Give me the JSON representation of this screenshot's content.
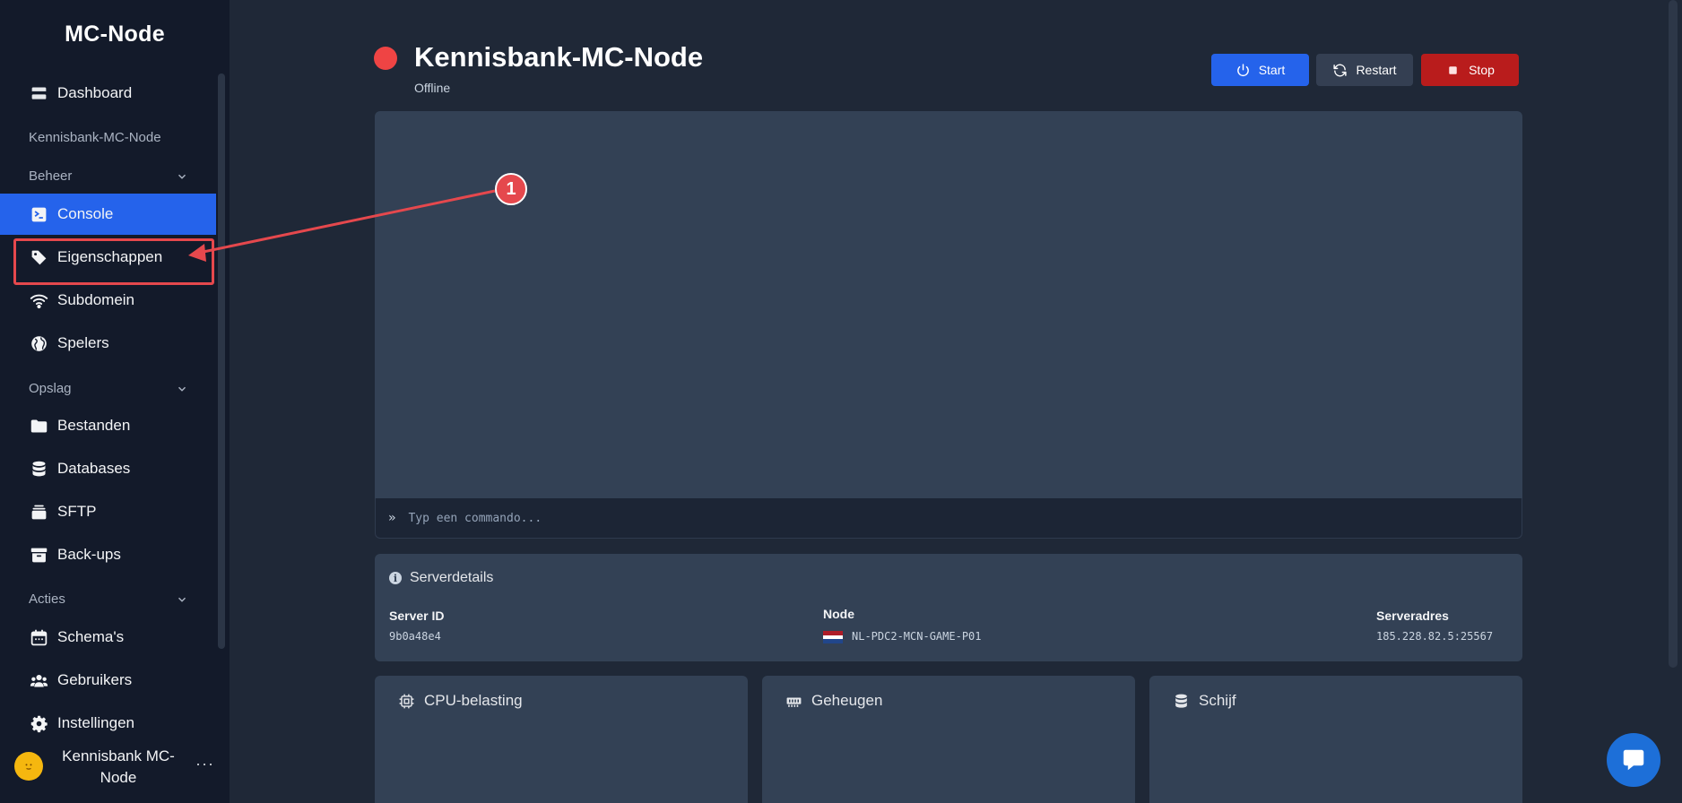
{
  "sidebar": {
    "brand": "MC-Node",
    "dashboard": "Dashboard",
    "server_heading": "Kennisbank-MC-Node",
    "sections": {
      "beheer": "Beheer",
      "opslag": "Opslag",
      "acties": "Acties"
    },
    "items": {
      "console": "Console",
      "eigenschappen": "Eigenschappen",
      "subdomein": "Subdomein",
      "spelers": "Spelers",
      "bestanden": "Bestanden",
      "databases": "Databases",
      "sftp": "SFTP",
      "backups": "Back-ups",
      "schemas": "Schema's",
      "gebruikers": "Gebruikers",
      "instellingen": "Instellingen"
    },
    "user": {
      "name": "Kennisbank MC-Node",
      "more": "···"
    }
  },
  "header": {
    "title": "Kennisbank-MC-Node",
    "status": "Offline",
    "status_color": "#ef4444"
  },
  "buttons": {
    "start": "Start",
    "restart": "Restart",
    "stop": "Stop"
  },
  "console": {
    "placeholder": "Typ een commando..."
  },
  "annotation": {
    "badge": "1",
    "color": "#e5484d"
  },
  "details": {
    "title": "Serverdetails",
    "server_id_label": "Server ID",
    "server_id": "9b0a48e4",
    "node_label": "Node",
    "node": "NL-PDC2-MCN-GAME-P01",
    "address_label": "Serveradres",
    "address": "185.228.82.5:25567"
  },
  "cards": {
    "cpu": "CPU-belasting",
    "memory": "Geheugen",
    "disk": "Schijf"
  },
  "colors": {
    "accent": "#2563eb",
    "danger": "#b91c1c",
    "sidebar_bg": "#131a2a",
    "panel_bg": "#334155"
  }
}
